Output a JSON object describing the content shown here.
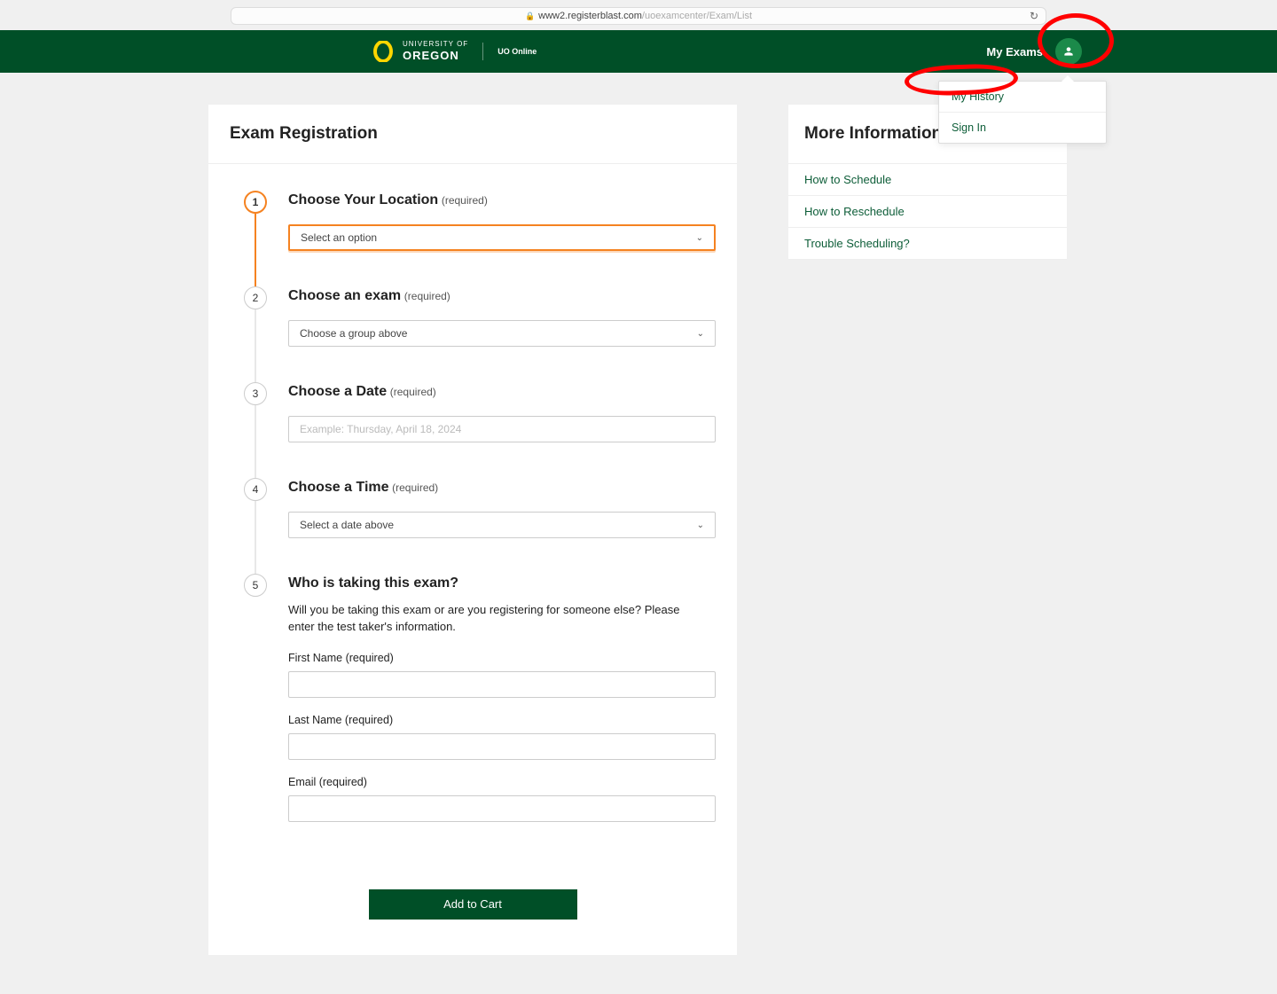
{
  "url": {
    "domain": "www2.registerblast.com",
    "path": "/uoexamcenter/Exam/List"
  },
  "header": {
    "brand_small": "UNIVERSITY OF",
    "brand_big": "OREGON",
    "brand_sub": "UO Online",
    "my_exams": "My Exams",
    "dropdown": {
      "history": "My History",
      "signin": "Sign In"
    }
  },
  "main": {
    "title": "Exam Registration",
    "steps": {
      "s1": {
        "num": "1",
        "title": "Choose Your Location",
        "req": "(required)",
        "placeholder": "Select an option"
      },
      "s2": {
        "num": "2",
        "title": "Choose an exam",
        "req": "(required)",
        "placeholder": "Choose a group above"
      },
      "s3": {
        "num": "3",
        "title": "Choose a Date",
        "req": "(required)",
        "placeholder": "Example: Thursday, April 18, 2024"
      },
      "s4": {
        "num": "4",
        "title": "Choose a Time",
        "req": "(required)",
        "placeholder": "Select a date above"
      },
      "s5": {
        "num": "5",
        "title": "Who is taking this exam?",
        "desc": "Will you be taking this exam or are you registering for someone else? Please enter the test taker's information.",
        "first": "First Name (required)",
        "last": "Last Name (required)",
        "email": "Email (required)"
      }
    },
    "add_cart": "Add to Cart"
  },
  "side": {
    "title": "More Information",
    "items": {
      "i0": "How to Schedule",
      "i1": "How to Reschedule",
      "i2": "Trouble Scheduling?"
    }
  }
}
